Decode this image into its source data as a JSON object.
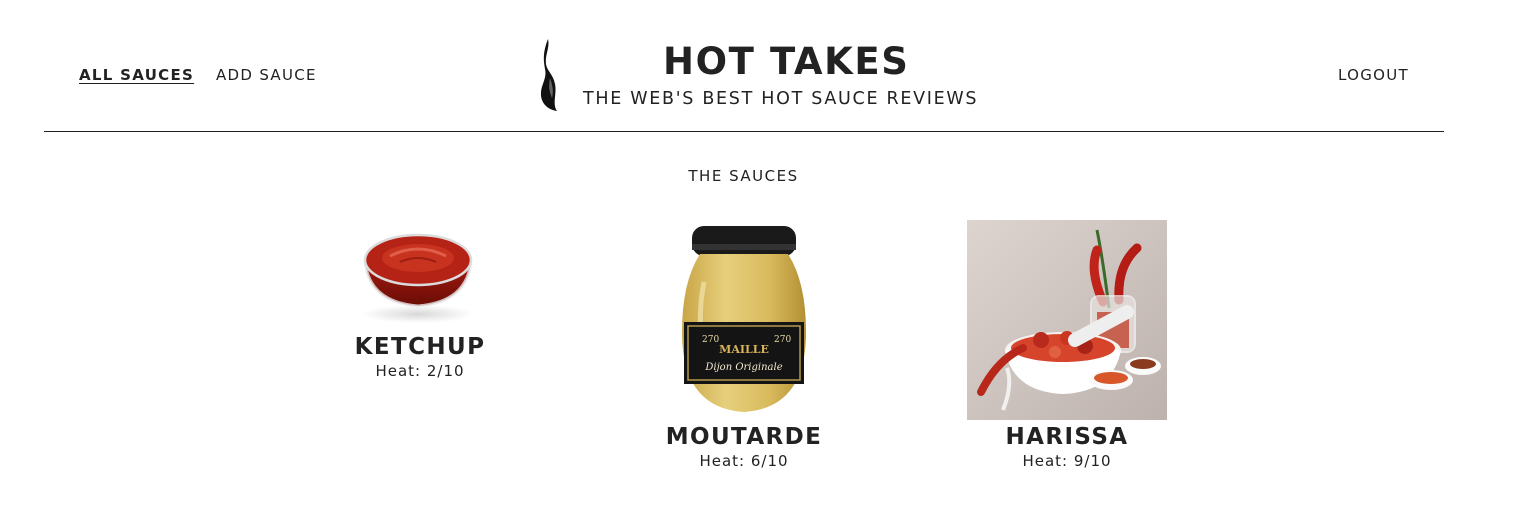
{
  "header": {
    "nav": {
      "all_sauces": "ALL SAUCES",
      "add_sauce": "ADD SAUCE",
      "logout": "LOGOUT"
    },
    "title": "HOT TAKES",
    "subtitle": "THE WEB'S BEST HOT SAUCE REVIEWS"
  },
  "main": {
    "section_title": "THE SAUCES",
    "sauces": [
      {
        "name": "KETCHUP",
        "heat": "Heat: 2/10"
      },
      {
        "name": "MOUTARDE",
        "heat": "Heat: 6/10"
      },
      {
        "name": "HARISSA",
        "heat": "Heat: 9/10"
      }
    ]
  },
  "images": {
    "moutarde_label_brand": "MAILLE",
    "moutarde_label_product": "Dijon Originale",
    "moutarde_label_weight": "270"
  },
  "icons": {
    "logo": "flame-icon"
  }
}
